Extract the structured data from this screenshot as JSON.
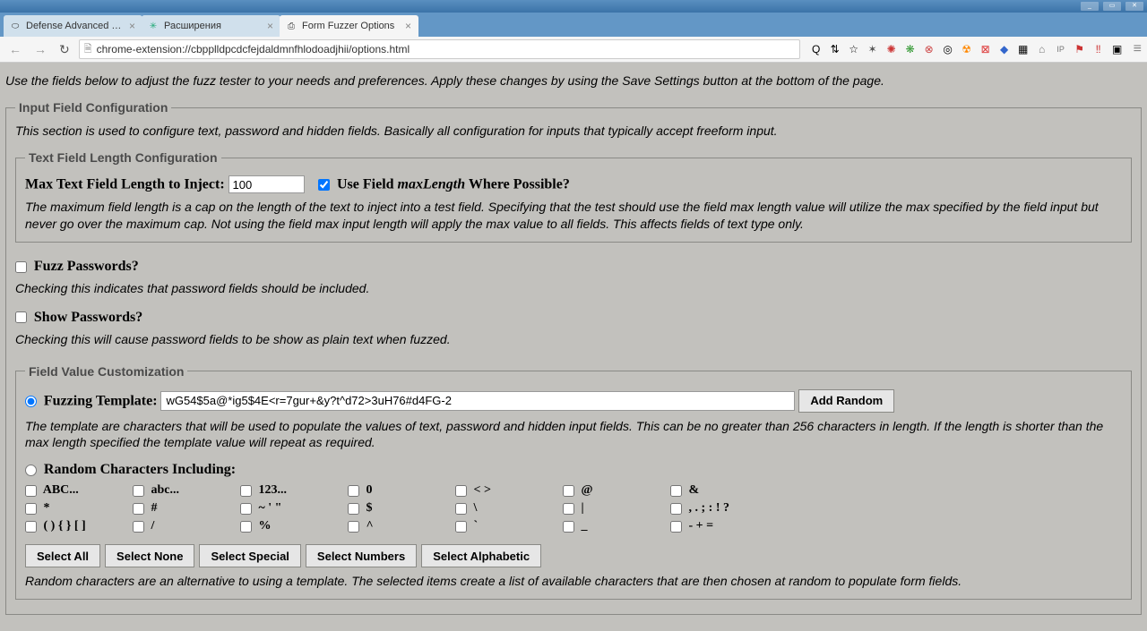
{
  "window": {
    "buttons": [
      "_",
      "▭",
      "✕"
    ]
  },
  "tabs": [
    {
      "label": "Defense Advanced Resear",
      "icon": "⬭",
      "active": false
    },
    {
      "label": "Расширения",
      "icon": "✳",
      "active": false
    },
    {
      "label": "Form Fuzzer Options",
      "icon": "⎙",
      "active": true
    }
  ],
  "toolbar": {
    "url": "chrome-extension://cbpplldpcdcfejdaldmnfhlodoadjhii/options.html",
    "ext_icons": [
      "Q",
      "⇅",
      "☆",
      "✶",
      "✺",
      "❋",
      "⊗",
      "◎",
      "☢",
      "⊠",
      "◆",
      "▦",
      "⌂",
      "IP",
      "⚑",
      "‼",
      "▣"
    ]
  },
  "page": {
    "intro": "Use the fields below to adjust the fuzz tester to your needs and preferences. Apply these changes by using the Save Settings button at the bottom of the page.",
    "input_cfg": {
      "legend": "Input Field Configuration",
      "desc": "This section is used to configure text, password and hidden fields. Basically all configuration for inputs that typically accept freeform input.",
      "textlen": {
        "legend": "Text Field Length Configuration",
        "label": "Max Text Field Length to Inject:",
        "value": "100",
        "use_maxlength_prefix": "Use Field ",
        "use_maxlength_italic": "maxLength",
        "use_maxlength_suffix": " Where Possible?",
        "desc": "The maximum field length is a cap on the length of the text to inject into a test field. Specifying that the test should use the field max length value will utilize the max specified by the field input but never go over the maximum cap. Not using the field max input length will apply the max value to all fields. This affects fields of text type only."
      },
      "fuzz_pw": {
        "label": "Fuzz Passwords?",
        "desc": "Checking this indicates that password fields should be included."
      },
      "show_pw": {
        "label": "Show Passwords?",
        "desc": "Checking this will cause password fields to be show as plain text when fuzzed."
      },
      "custom": {
        "legend": "Field Value Customization",
        "template_label": "Fuzzing Template:",
        "template_value": "wG54$5a@*ig5$4E<r=7gur+&y?t^d72>3uH76#d4FG-2",
        "add_random": "Add Random",
        "template_desc": "The template are characters that will be used to populate the values of text, password and hidden input fields. This can be no greater than 256 characters in length. If the length is shorter than the max length specified the template value will repeat as required.",
        "random_label": "Random Characters Including:",
        "grid": [
          [
            "ABC...",
            "abc...",
            "123...",
            "0",
            "< >",
            "@",
            "&"
          ],
          [
            "*",
            "#",
            "~ ' \"",
            "$",
            "\\",
            "|",
            ", . ; : ! ?"
          ],
          [
            "( ) { } [ ]",
            "/",
            "%",
            "^",
            "`",
            "_",
            "- + ="
          ]
        ],
        "buttons": [
          "Select All",
          "Select None",
          "Select Special",
          "Select Numbers",
          "Select Alphabetic"
        ],
        "random_desc": "Random characters are an alternative to using a template. The selected items create a list of available characters that are then chosen at random to populate form fields."
      }
    }
  }
}
